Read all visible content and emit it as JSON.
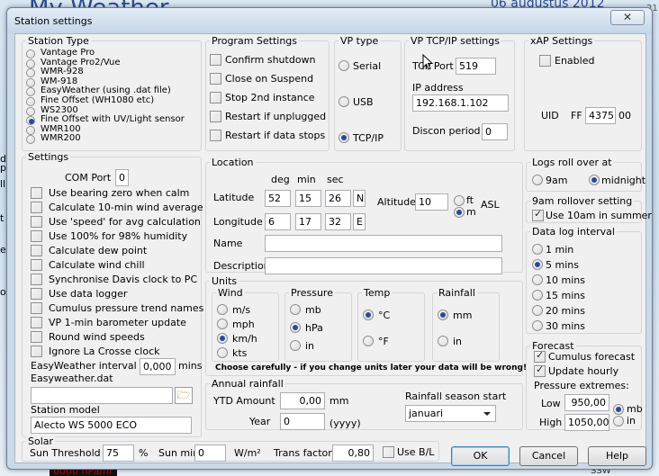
{
  "background": {
    "app_title": "My Weather",
    "date": "06 augustus 2012",
    "frag_d": "d",
    "frag_p": "p",
    "frag_ll": "ll",
    "frag_t": "t",
    "frag_o": "o",
    "frag_e": "e",
    "frag_2": "21",
    "frag_bottom": "0000 hPa/hr",
    "frag_dir": "SSW"
  },
  "window": {
    "title": "Station settings",
    "close_glyph": "✕"
  },
  "station_type": {
    "title": "Station Type",
    "options": [
      "Vantage Pro",
      "Vantage Pro2/Vue",
      "WMR-928",
      "WM-918",
      "EasyWeather (using .dat file)",
      "Fine Offset (WH1080 etc)",
      "WS2300",
      "Fine Offset with UV/Light sensor",
      "WMR100",
      "WMR200"
    ],
    "selected_index": 7
  },
  "program_settings": {
    "title": "Program Settings",
    "items": [
      {
        "label": "Confirm shutdown",
        "checked": false
      },
      {
        "label": "Close on Suspend",
        "checked": false
      },
      {
        "label": "Stop 2nd instance",
        "checked": false
      },
      {
        "label": "Restart if unplugged",
        "checked": false
      },
      {
        "label": "Restart if data stops",
        "checked": false
      }
    ]
  },
  "vp_type": {
    "title": "VP type",
    "options": [
      "Serial",
      "USB",
      "TCP/IP"
    ],
    "selected_index": 2
  },
  "vp_tcpip": {
    "title": "VP TCP/IP settings",
    "tcp_port_label": "TCP Port",
    "tcp_port": "519",
    "ip_label": "IP address",
    "ip": "192.168.1.102",
    "discon_label": "Discon period",
    "discon": "0"
  },
  "xap": {
    "title": "xAP Settings",
    "enabled_label": "Enabled",
    "enabled": false,
    "uid_label": "UID",
    "uid_prefix": "FF",
    "uid_value": "4375",
    "uid_suffix": "00"
  },
  "settings": {
    "title": "Settings",
    "com_port_label": "COM Port",
    "com_port": "0",
    "items": [
      {
        "label": "Use bearing zero when calm",
        "checked": false
      },
      {
        "label": "Calculate 10-min wind average",
        "checked": false
      },
      {
        "label": "Use 'speed' for avg calculation",
        "checked": false
      },
      {
        "label": "Use 100% for 98% humidity",
        "checked": false
      },
      {
        "label": "Calculate dew point",
        "checked": false
      },
      {
        "label": "Calculate wind chill",
        "checked": false
      },
      {
        "label": "Synchronise Davis clock to PC",
        "checked": false
      },
      {
        "label": "Use data logger",
        "checked": false
      },
      {
        "label": "Cumulus pressure trend names",
        "checked": false
      },
      {
        "label": "VP 1-min barometer update",
        "checked": false
      },
      {
        "label": "Round wind speeds",
        "checked": false
      },
      {
        "label": "Ignore La Crosse clock",
        "checked": false
      }
    ],
    "ew_interval_label": "EasyWeather interval",
    "ew_interval": "0,000",
    "ew_interval_unit": "mins",
    "ew_dat_label": "Easyweather.dat",
    "ew_dat_value": "",
    "station_model_label": "Station model",
    "station_model": "Alecto WS 5000 ECO"
  },
  "location": {
    "title": "Location",
    "deg": "deg",
    "min": "min",
    "sec": "sec",
    "latitude_label": "Latitude",
    "lat_deg": "52",
    "lat_min": "15",
    "lat_sec": "26",
    "lat_hem": "N",
    "longitude_label": "Longitude",
    "lon_deg": "6",
    "lon_min": "17",
    "lon_sec": "32",
    "lon_hem": "E",
    "altitude_label": "Altitude",
    "altitude": "10",
    "alt_units": [
      "ft",
      "m"
    ],
    "alt_selected": 1,
    "asl": "ASL",
    "name_label": "Name",
    "name": "",
    "description_label": "Description",
    "description": ""
  },
  "units": {
    "title": "Units",
    "wind": {
      "title": "Wind",
      "options": [
        "m/s",
        "mph",
        "km/h",
        "kts"
      ],
      "selected_index": 2
    },
    "pressure": {
      "title": "Pressure",
      "options": [
        "mb",
        "hPa",
        "in"
      ],
      "selected_index": 1
    },
    "temp": {
      "title": "Temp",
      "options": [
        "°C",
        "°F"
      ],
      "selected_index": 0
    },
    "rainfall": {
      "title": "Rainfall",
      "options": [
        "mm",
        "in"
      ],
      "selected_index": 0
    },
    "warning": "Choose carefully - if you change units later your data will be wrong!"
  },
  "annual_rainfall": {
    "title": "Annual rainfall",
    "ytd_label": "YTD Amount",
    "ytd": "0,00",
    "ytd_unit": "mm",
    "year_label": "Year",
    "year": "0",
    "year_hint": "(yyyy)",
    "season_label": "Rainfall season start",
    "season": "januari"
  },
  "logs_roll": {
    "title": "Logs roll over at",
    "options": [
      "9am",
      "midnight"
    ],
    "selected_index": 1
  },
  "rollover_9am": {
    "title": "9am rollover setting",
    "label": "Use 10am in summer",
    "checked": true
  },
  "data_log": {
    "title": "Data log interval",
    "options": [
      "1 min",
      "5 mins",
      "10 mins",
      "15 mins",
      "20 mins",
      "30 mins"
    ],
    "selected_index": 1
  },
  "forecast": {
    "title": "Forecast",
    "cumulus_label": "Cumulus forecast",
    "cumulus": true,
    "update_label": "Update hourly",
    "update": true,
    "extremes_label": "Pressure extremes:",
    "low_label": "Low",
    "low": "950,00",
    "high_label": "High",
    "high": "1050,00",
    "units": [
      "mb",
      "in"
    ],
    "unit_selected": 0
  },
  "solar": {
    "title": "Solar",
    "threshold_label": "Sun Threshold",
    "threshold": "75",
    "threshold_unit": "%",
    "sunmin_label": "Sun min",
    "sunmin": "0",
    "sunmin_unit": "W/m²",
    "transfactor_label": "Trans factor",
    "transfactor": "0,80",
    "useBL_label": "Use B/L",
    "useBL": false
  },
  "buttons": {
    "ok": "OK",
    "cancel": "Cancel",
    "help": "Help"
  }
}
